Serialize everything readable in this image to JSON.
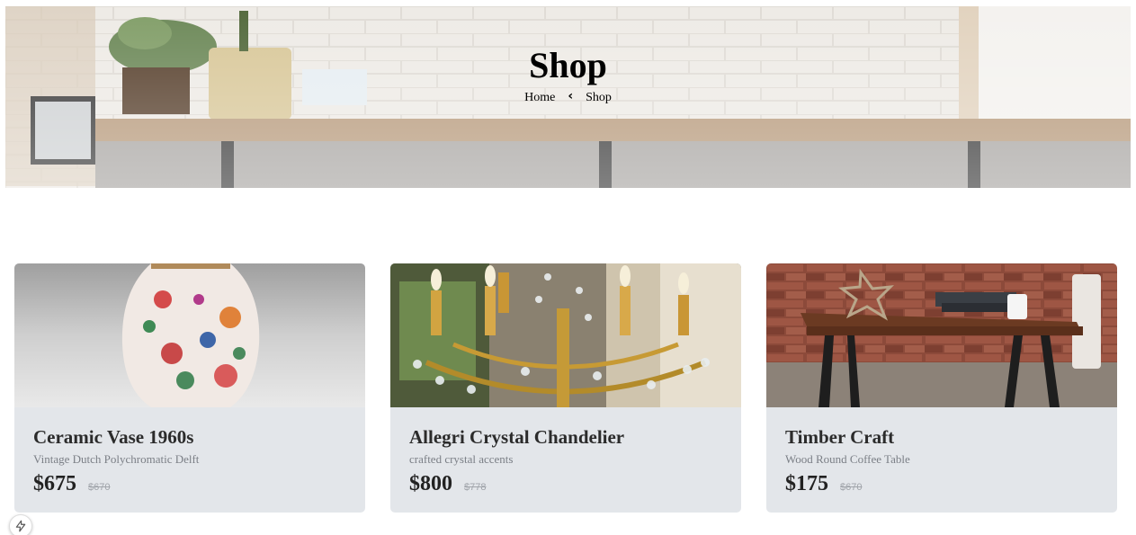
{
  "hero": {
    "title": "Shop",
    "breadcrumb": {
      "home": "Home",
      "current": "Shop",
      "separator_icon": "chevron-left-icon"
    }
  },
  "products": [
    {
      "title": "Ceramic Vase 1960s",
      "subtitle": "Vintage Dutch Polychromatic Delft",
      "price": "$675",
      "old_price": "$670",
      "image": "vase-image"
    },
    {
      "title": "Allegri Crystal Chandelier",
      "subtitle": "crafted crystal accents",
      "price": "$800",
      "old_price": "$778",
      "image": "chandelier-image"
    },
    {
      "title": "Timber Craft",
      "subtitle": "Wood Round Coffee Table",
      "price": "$175",
      "old_price": "$670",
      "image": "coffee-table-image"
    }
  ],
  "floating": {
    "icon": "lightning-bolt-icon"
  },
  "colors": {
    "card_bg": "#e3e6ea",
    "subtitle": "#7b7f86",
    "old_price": "#a0a4aa"
  }
}
